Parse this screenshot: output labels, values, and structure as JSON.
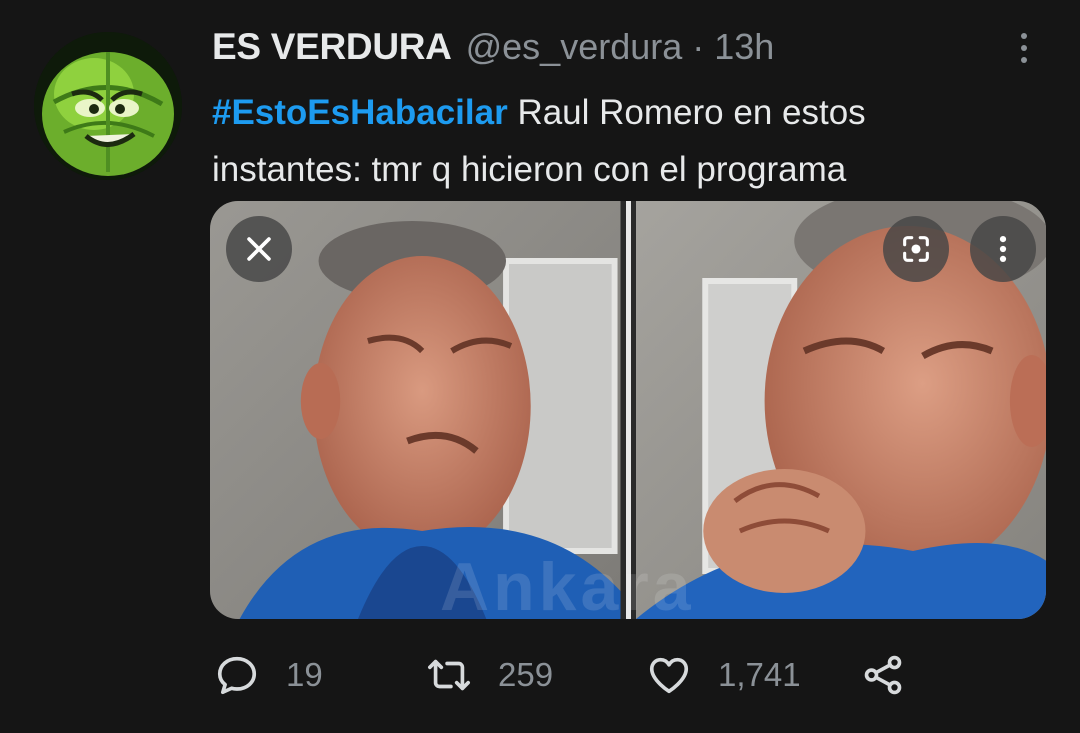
{
  "author": {
    "display_name": "ES VERDURA",
    "handle": "@es_verdura",
    "separator": "·",
    "time": "13h"
  },
  "tweet": {
    "hashtag": "#EstoEsHabacilar",
    "text": " Raul Romero en estos instantes: tmr q hicieron con el programa"
  },
  "media": {
    "watermark": "Ankara"
  },
  "actions": {
    "replies": "19",
    "retweets": "259",
    "likes": "1,741"
  },
  "icons": {
    "close": "close-icon",
    "lens": "lens-icon",
    "more": "more-vertical-icon",
    "reply": "reply-icon",
    "retweet": "retweet-icon",
    "like": "heart-icon",
    "share": "share-icon"
  },
  "colors": {
    "background": "#151515",
    "text": "#e7e9ea",
    "secondary": "#8b9197",
    "hashtag": "#1d9bf0"
  }
}
